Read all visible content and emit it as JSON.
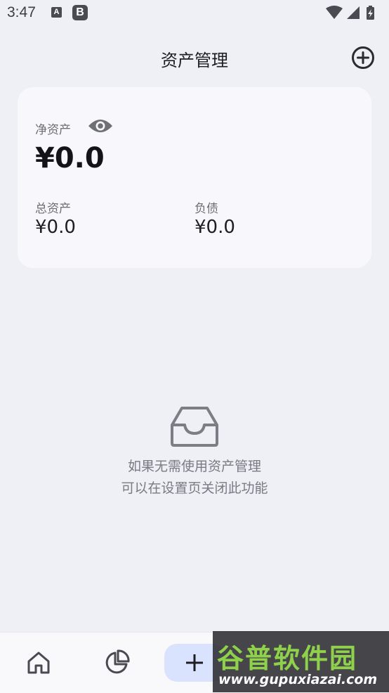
{
  "status_bar": {
    "time": "3:47",
    "icon_a": "A",
    "icon_b": "B",
    "icons": [
      "wifi-icon",
      "signal-icon",
      "battery-charging-icon"
    ]
  },
  "header": {
    "title": "资产管理",
    "add_icon": "add-circle-icon"
  },
  "summary": {
    "net_assets_label": "净资产",
    "net_assets_value": "¥0.0",
    "visibility_icon": "eye-icon",
    "total_assets_label": "总资产",
    "total_assets_value": "¥0.0",
    "liabilities_label": "负债",
    "liabilities_value": "¥0.0"
  },
  "empty_state": {
    "icon": "inbox-icon",
    "line1": "如果无需使用资产管理",
    "line2": "可以在设置页关闭此功能"
  },
  "bottom_nav": {
    "items": [
      {
        "icon": "home-icon"
      },
      {
        "icon": "pie-chart-icon"
      },
      {
        "icon": "plus-icon"
      }
    ]
  },
  "watermark": {
    "logo": "谷普软件园",
    "url": "www.gupuxiazai.com"
  },
  "colors": {
    "background": "#eef0f6",
    "card": "#f8f8fc",
    "accent_button": "#d9e3fd",
    "text_primary": "#1d1d22",
    "text_secondary": "#6c6c74",
    "watermark_green": "#8fd14a"
  }
}
